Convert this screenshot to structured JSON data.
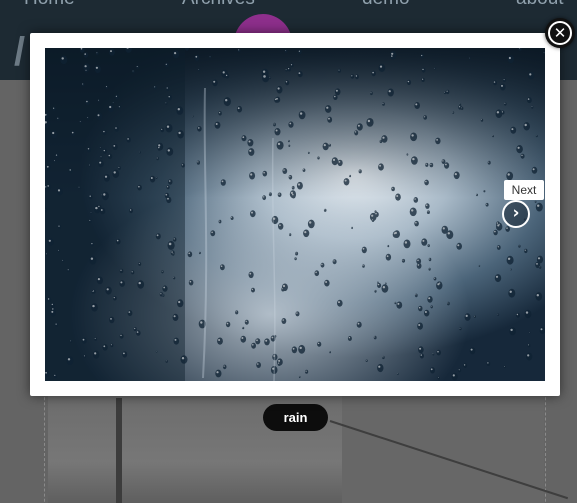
{
  "background": {
    "nav": {
      "home": "Home",
      "archives": "Archives",
      "demo": "demo",
      "about": "about"
    },
    "logo_glyph": "/",
    "tag": "rain"
  },
  "lightbox": {
    "next_tooltip": "Next",
    "close_glyph": "✕",
    "next_glyph": "›",
    "image_icon": "rain-on-window-photo"
  },
  "colors": {
    "header": "#1d2a33",
    "overlay": "#646464",
    "tag_bg": "#0d0d0d",
    "avatar": "#8e2f8c"
  }
}
